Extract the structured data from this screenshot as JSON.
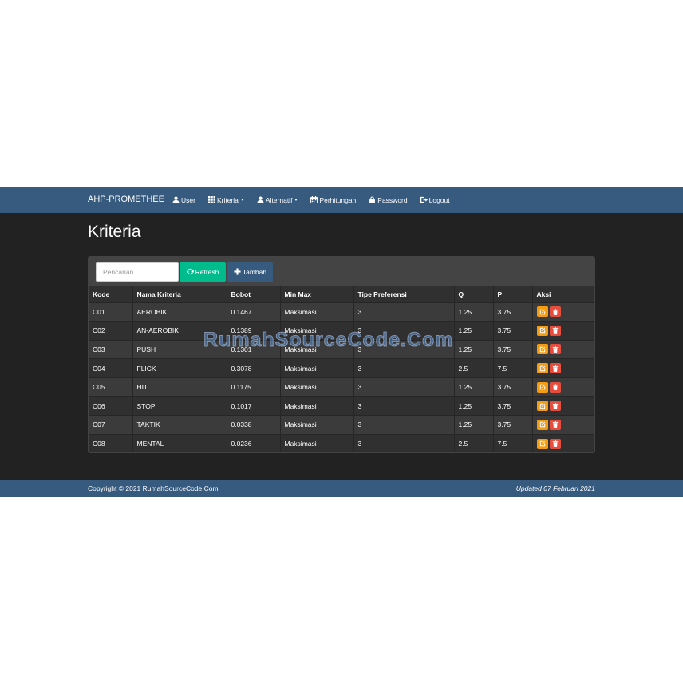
{
  "navbar": {
    "brand": "AHP-PROMETHEE",
    "items": [
      {
        "label": "User",
        "icon": "user-icon",
        "dropdown": false
      },
      {
        "label": "Kriteria",
        "icon": "th-icon",
        "dropdown": true
      },
      {
        "label": "Alternatif",
        "icon": "user-icon",
        "dropdown": true
      },
      {
        "label": "Perhitungan",
        "icon": "calendar-icon",
        "dropdown": false
      },
      {
        "label": "Password",
        "icon": "lock-icon",
        "dropdown": false
      },
      {
        "label": "Logout",
        "icon": "logout-icon",
        "dropdown": false
      }
    ]
  },
  "page": {
    "title": "Kriteria"
  },
  "toolbar": {
    "search_placeholder": "Pencarian...",
    "refresh_label": "Refresh",
    "add_label": "Tambah"
  },
  "table": {
    "headers": [
      "Kode",
      "Nama Kriteria",
      "Bobot",
      "Min Max",
      "Tipe Preferensi",
      "Q",
      "P",
      "Aksi"
    ],
    "rows": [
      [
        "C01",
        "AEROBIK",
        "0.1467",
        "Maksimasi",
        "3",
        "1.25",
        "3.75"
      ],
      [
        "C02",
        "AN-AEROBIK",
        "0.1389",
        "Maksimasi",
        "3",
        "1.25",
        "3.75"
      ],
      [
        "C03",
        "PUSH",
        "0.1301",
        "Maksimasi",
        "3",
        "1.25",
        "3.75"
      ],
      [
        "C04",
        "FLICK",
        "0.3078",
        "Maksimasi",
        "3",
        "2.5",
        "7.5"
      ],
      [
        "C05",
        "HIT",
        "0.1175",
        "Maksimasi",
        "3",
        "1.25",
        "3.75"
      ],
      [
        "C06",
        "STOP",
        "0.1017",
        "Maksimasi",
        "3",
        "1.25",
        "3.75"
      ],
      [
        "C07",
        "TAKTIK",
        "0.0338",
        "Maksimasi",
        "3",
        "1.25",
        "3.75"
      ],
      [
        "C08",
        "MENTAL",
        "0.0236",
        "Maksimasi",
        "3",
        "2.5",
        "7.5"
      ]
    ]
  },
  "watermark": "RumahSourceCode.Com",
  "footer": {
    "copyright": "Copyright © 2021 RumahSourceCode.Com",
    "updated": "Updated 07 Februari 2021"
  },
  "colors": {
    "navbar": "#375a7f",
    "background": "#222222",
    "success": "#00bc8c",
    "warning": "#f39c12",
    "danger": "#e74c3c"
  }
}
